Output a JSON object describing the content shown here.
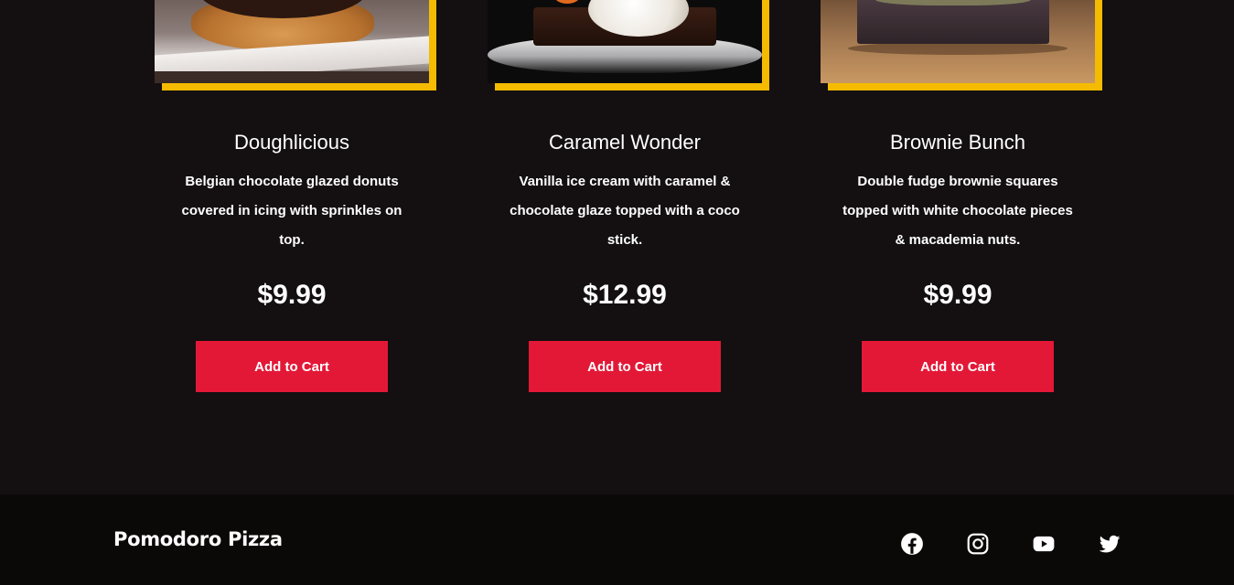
{
  "menu": {
    "items": [
      {
        "name": "Doughlicious",
        "description": "Belgian chocolate glazed donuts covered in icing with sprinkles on top.",
        "price": "$9.99",
        "button": "Add to Cart"
      },
      {
        "name": "Caramel Wonder",
        "description": "Vanilla ice cream with caramel & chocolate glaze topped with a coco stick.",
        "price": "$12.99",
        "button": "Add to Cart"
      },
      {
        "name": "Brownie Bunch",
        "description": "Double fudge brownie squares topped with white chocolate pieces & macademia nuts.",
        "price": "$9.99",
        "button": "Add to Cart"
      }
    ]
  },
  "footer": {
    "brand": "Pomodoro Pizza",
    "social": [
      "facebook-icon",
      "instagram-icon",
      "youtube-icon",
      "twitter-icon"
    ]
  },
  "colors": {
    "background": "#140f10",
    "footer_background": "#0b0808",
    "accent_button": "#e31837",
    "frame_gold": "#f5bb00"
  }
}
